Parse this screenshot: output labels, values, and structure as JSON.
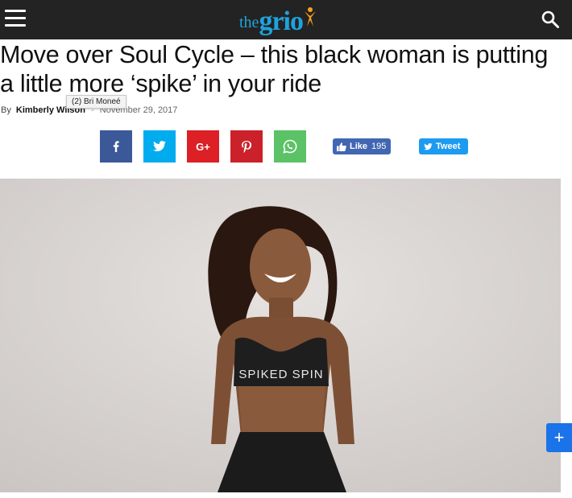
{
  "header": {
    "logo_the": "the",
    "logo_grio": "grio",
    "menu_icon": "hamburger-menu-icon",
    "search_icon": "search-icon",
    "background_color": "#232323",
    "logo_color": "#1ea3dd",
    "logo_accent_color": "#f7a21b"
  },
  "article": {
    "title": "Move over Soul Cycle – this black woman is putting a little more ‘spike’ in your ride",
    "by_label": "By",
    "author": "Kimberly Wilson",
    "separator": "-",
    "date": "November 29, 2017",
    "tooltip": "(2) Bri Moneé"
  },
  "share": {
    "buttons": [
      {
        "name": "facebook",
        "icon": "facebook-icon",
        "color": "#3b5998"
      },
      {
        "name": "twitter",
        "icon": "twitter-icon",
        "color": "#00aced"
      },
      {
        "name": "google-plus",
        "icon": "google-plus-icon",
        "color": "#dd1f26"
      },
      {
        "name": "pinterest",
        "icon": "pinterest-icon",
        "color": "#ca212a"
      },
      {
        "name": "whatsapp",
        "icon": "whatsapp-icon",
        "color": "#5bc266"
      }
    ],
    "like_label": "Like",
    "like_count": "195",
    "tweet_label": "Tweet",
    "google_glyph": "G+"
  },
  "image": {
    "shirt_text": "SPIKED SPIN"
  },
  "floating": {
    "plus_label": "+",
    "color": "#1a73e8"
  }
}
